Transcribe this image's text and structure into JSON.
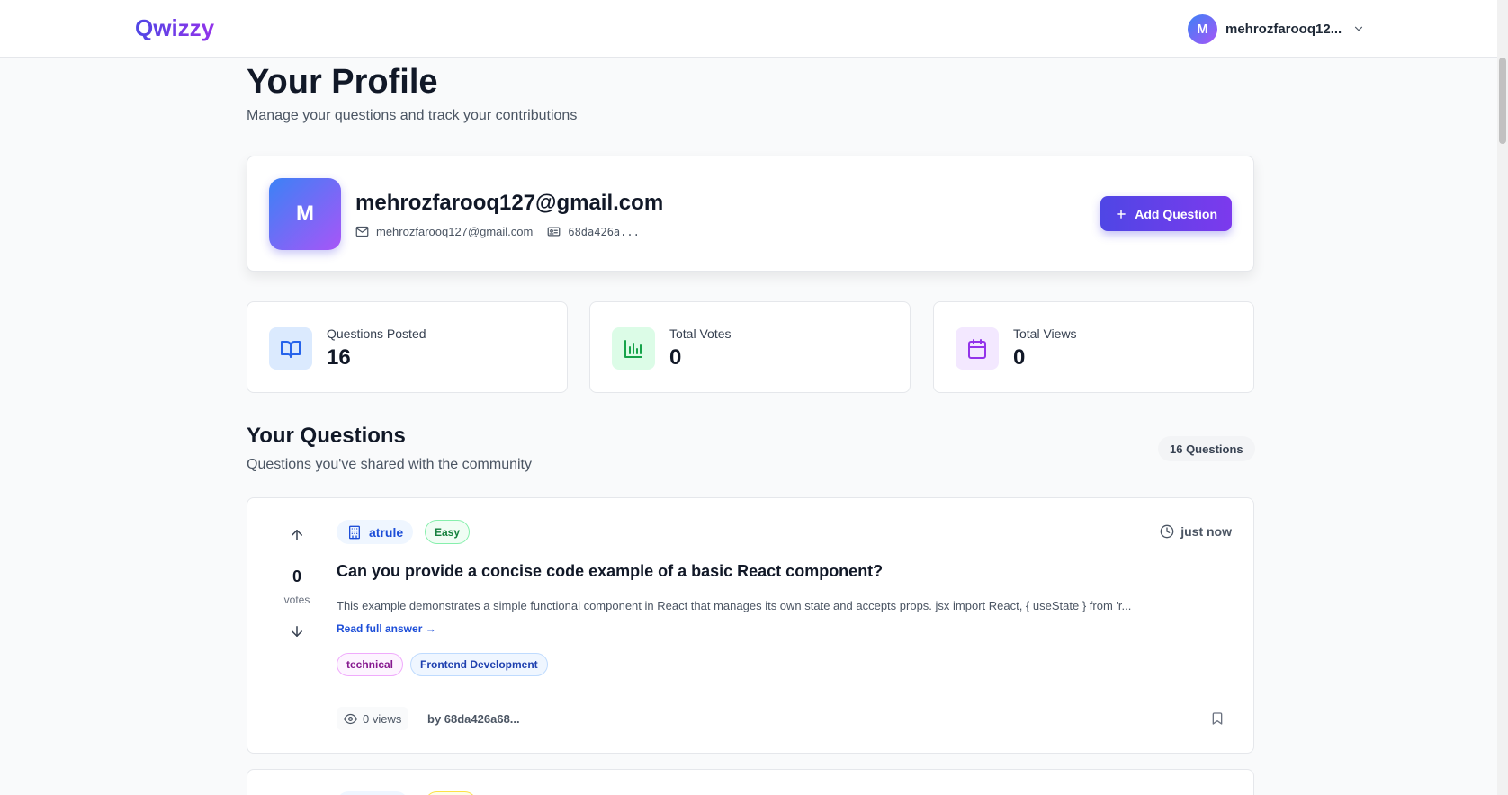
{
  "header": {
    "logo": "Qwizzy",
    "user_initial": "M",
    "user_name": "mehrozfarooq12..."
  },
  "page": {
    "title": "Your Profile",
    "subtitle": "Manage your questions and track your contributions"
  },
  "profile": {
    "initial": "M",
    "name": "mehrozfarooq127@gmail.com",
    "email": "mehrozfarooq127@gmail.com",
    "id_short": "68da426a...",
    "add_button": "Add Question"
  },
  "stats": [
    {
      "label": "Questions Posted",
      "value": "16",
      "icon": "book-icon",
      "color": "#2563eb",
      "bg": "#dbeafe"
    },
    {
      "label": "Total Votes",
      "value": "0",
      "icon": "bar-chart-icon",
      "color": "#16a34a",
      "bg": "#dcfce7"
    },
    {
      "label": "Total Views",
      "value": "0",
      "icon": "calendar-icon",
      "color": "#9333ea",
      "bg": "#f3e8ff"
    }
  ],
  "questions_section": {
    "title": "Your Questions",
    "subtitle": "Questions you've shared with the community",
    "count_label": "16 Questions"
  },
  "question": {
    "votes": "0",
    "votes_label": "votes",
    "company": "atrule",
    "difficulty": "Easy",
    "time": "just now",
    "title": "Can you provide a concise code example of a basic React component?",
    "excerpt": "This example demonstrates a simple functional component in React that manages its own state and accepts props. jsx import React, { useState } from 'r...",
    "read_more": "Read full answer →",
    "tags": [
      "technical",
      "Frontend Development"
    ],
    "views": "0 views",
    "author": "by 68da426a68..."
  }
}
